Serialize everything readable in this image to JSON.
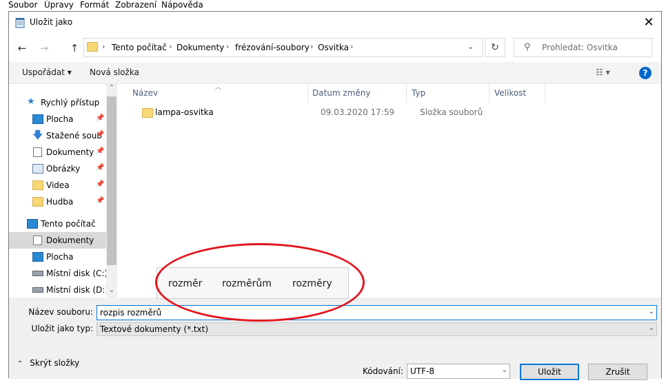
{
  "background_app": {
    "menu": [
      "Soubor",
      "Úpravy",
      "Formát",
      "Zobrazení",
      "Nápověda"
    ]
  },
  "dialog": {
    "title": "Uložit jako",
    "close_symbol": "✕"
  },
  "nav": {
    "back_symbol": "←",
    "forward_symbol": "→",
    "up_symbol": "↑",
    "breadcrumb": [
      "Tento počítač",
      "Dokumenty",
      "frézování-soubory",
      "Osvitka"
    ],
    "refresh_symbol": "↻",
    "search_placeholder": "Prohledat: Osvitka"
  },
  "commands": {
    "organize": "Uspořádat ▾",
    "new_folder": "Nová složka",
    "view_symbol": "☷ ▾",
    "help": "?"
  },
  "sidebar": {
    "items": [
      {
        "label": "Rychlý přístup",
        "icon": "star-icon",
        "pinned": false
      },
      {
        "label": "Plocha",
        "icon": "desktop-icon",
        "pinned": true
      },
      {
        "label": "Stažené soub",
        "icon": "download-icon",
        "pinned": true
      },
      {
        "label": "Dokumenty",
        "icon": "document-icon",
        "pinned": true
      },
      {
        "label": "Obrázky",
        "icon": "pictures-icon",
        "pinned": true
      },
      {
        "label": "Videa",
        "icon": "folder-icon",
        "pinned": true
      },
      {
        "label": "Hudba",
        "icon": "folder-icon",
        "pinned": true
      },
      {
        "label": "Tento počítač",
        "icon": "computer-icon",
        "pinned": false
      },
      {
        "label": "Dokumenty",
        "icon": "document-icon",
        "pinned": false,
        "selected": true
      },
      {
        "label": "Plocha",
        "icon": "desktop-icon",
        "pinned": false
      },
      {
        "label": "Místní disk (C:)",
        "icon": "drive-icon",
        "pinned": false
      },
      {
        "label": "Místní disk (D:)",
        "icon": "drive-icon",
        "pinned": false
      }
    ]
  },
  "filelist": {
    "columns": [
      "Název",
      "Datum změny",
      "Typ",
      "Velikost"
    ],
    "rows": [
      {
        "name": "lampa-osvitka",
        "date": "09.03.2020 17:59",
        "type": "Složka souborů",
        "size": ""
      }
    ]
  },
  "autocomplete": {
    "suggestions": [
      "rozměr",
      "rozměrům",
      "rozměry"
    ]
  },
  "form": {
    "filename_label": "Název souboru:",
    "filename_value": "rozpis rozměrů",
    "filetype_label": "Uložit jako typ:",
    "filetype_value": "Textové dokumenty (*.txt)",
    "hide_folders": "Skrýt složky",
    "encoding_label": "Kódování:",
    "encoding_value": "UTF-8",
    "save_label": "Uložit",
    "cancel_label": "Zrušit"
  },
  "colors": {
    "accent": "#0078d7",
    "annotation": "#e3161e",
    "folder": "#f8d775"
  }
}
